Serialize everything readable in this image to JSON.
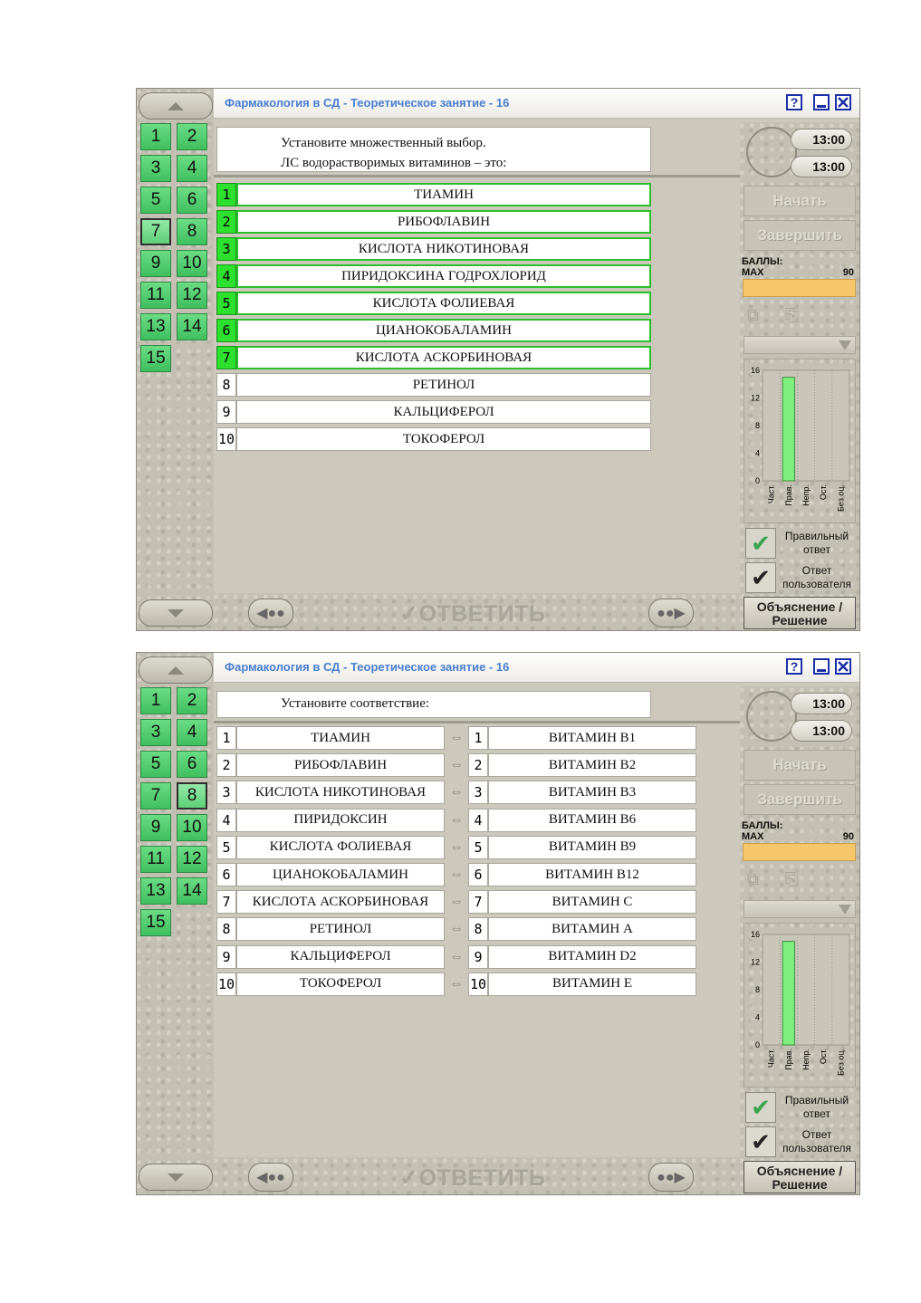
{
  "windows": [
    {
      "title": "Фармакология в СД - Теоретическое занятие - 16",
      "help_label": "?",
      "question_lines": [
        "Установите множественный выбор.",
        "ЛС водорастворимых витаминов – это:"
      ],
      "options": [
        {
          "num": "1",
          "text": "ТИАМИН",
          "selected": true
        },
        {
          "num": "2",
          "text": "РИБОФЛАВИН",
          "selected": true
        },
        {
          "num": "3",
          "text": "КИСЛОТА НИКОТИНОВАЯ",
          "selected": true
        },
        {
          "num": "4",
          "text": "ПИРИДОКСИНА ГОДРОХЛОРИД",
          "selected": true
        },
        {
          "num": "5",
          "text": "КИСЛОТА ФОЛИЕВАЯ",
          "selected": true
        },
        {
          "num": "6",
          "text": "ЦИАНОКОБАЛАМИН",
          "selected": true
        },
        {
          "num": "7",
          "text": "КИСЛОТА АСКОРБИНОВАЯ",
          "selected": true
        },
        {
          "num": "8",
          "text": "РЕТИНОЛ",
          "selected": false
        },
        {
          "num": "9",
          "text": "КАЛЬЦИФЕРОЛ",
          "selected": false
        },
        {
          "num": "10",
          "text": "ТОКОФЕРОЛ",
          "selected": false
        }
      ],
      "current_question": "7"
    },
    {
      "title": "Фармакология в СД - Теоретическое занятие - 16",
      "help_label": "?",
      "question_lines": [
        "Установите соответствие:"
      ],
      "pairs": [
        {
          "num": "1",
          "left": "ТИАМИН",
          "right": "ВИТАМИН В1"
        },
        {
          "num": "2",
          "left": "РИБОФЛАВИН",
          "right": "ВИТАМИН В2"
        },
        {
          "num": "3",
          "left": "КИСЛОТА НИКОТИНОВАЯ",
          "right": "ВИТАМИН В3"
        },
        {
          "num": "4",
          "left": "ПИРИДОКСИН",
          "right": "ВИТАМИН В6"
        },
        {
          "num": "5",
          "left": "КИСЛОТА ФОЛИЕВАЯ",
          "right": "ВИТАМИН В9"
        },
        {
          "num": "6",
          "left": "ЦИАНОКОБАЛАМИН",
          "right": "ВИТАМИН В12"
        },
        {
          "num": "7",
          "left": "КИСЛОТА АСКОРБИНОВАЯ",
          "right": "ВИТАМИН С"
        },
        {
          "num": "8",
          "left": "РЕТИНОЛ",
          "right": "ВИТАМИН А"
        },
        {
          "num": "9",
          "left": "КАЛЬЦИФЕРОЛ",
          "right": "ВИТАМИН D2"
        },
        {
          "num": "10",
          "left": "ТОКОФЕРОЛ",
          "right": "ВИТАМИН Е"
        }
      ],
      "current_question": "8"
    }
  ],
  "question_numbers": [
    "1",
    "2",
    "3",
    "4",
    "5",
    "6",
    "7",
    "8",
    "9",
    "10",
    "11",
    "12",
    "13",
    "14",
    "15"
  ],
  "timer": {
    "time1": "13:00",
    "time2": "13:00"
  },
  "buttons": {
    "start": "Начать",
    "finish": "Завершить",
    "answer": "ОТВЕТИТЬ",
    "explain_line1": "Объяснение /",
    "explain_line2": "Решение"
  },
  "score": {
    "label": "БАЛЛЫ:",
    "max_label": "MAX",
    "max_value": "90"
  },
  "legend": {
    "correct_line1": "Правильный",
    "correct_line2": "ответ",
    "user_line1": "Ответ",
    "user_line2": "пользователя"
  },
  "chart_data": {
    "type": "bar",
    "categories": [
      "Част.",
      "Прав.",
      "Непр.",
      "Ост.",
      "Без оц."
    ],
    "values": [
      0,
      15,
      0,
      0,
      0
    ],
    "ylim": [
      0,
      16
    ],
    "yticks": [
      0,
      4,
      8,
      12,
      16
    ],
    "bar_color": "#7ff07f",
    "grid": true
  },
  "colors": {
    "accent_green": "#2ee02e",
    "question_tile": "#4fcc6c",
    "title_text": "#4a7fd0",
    "score_bar": "#f5c66a"
  }
}
